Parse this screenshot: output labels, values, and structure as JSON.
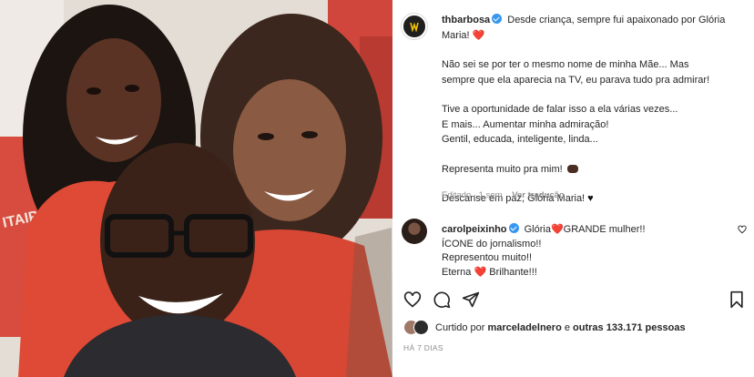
{
  "post": {
    "author": "thbarbosa",
    "caption_lines": [
      "Desde criança, sempre fui apaixonado por Glória",
      "Maria! "
    ],
    "para2": [
      "Não sei se por ter o mesmo nome de minha Mãe... Mas",
      "sempre que ela aparecia na TV, eu parava tudo pra admirar!"
    ],
    "para3": [
      "Tive a oportunidade de falar isso a ela várias vezes...",
      "E mais... Aumentar minha admiração!",
      "Gentil, educada, inteligente, linda..."
    ],
    "para4": "Representa muito pra mim! ",
    "para5": "Descanse em paz, Glória Maria! ",
    "edited": "Editado · 1 sem",
    "translate": "Ver tradução"
  },
  "comment": {
    "author": "carolpeixinho",
    "line1_a": "Glória",
    "line1_b": "GRANDE mulher!!",
    "line2": "ÍCONE do jornalismo!!",
    "line3": "Representou muito!!",
    "line4_a": "Eterna",
    "line4_b": "Brilhante!!!"
  },
  "likes": {
    "prefix": "Curtido por ",
    "user": "marceladelnero",
    "middle": " e ",
    "count": "outras 133.171 pessoas"
  },
  "timestamp": "HÁ 7 DIAS",
  "icons": {
    "like": "heart-outline-icon",
    "comment": "comment-bubble-icon",
    "share": "paper-plane-icon",
    "save": "bookmark-icon"
  },
  "colors": {
    "verified": "#3897f0",
    "heart": "#ed1c24",
    "muted": "#8e8e8e",
    "text": "#262626"
  }
}
